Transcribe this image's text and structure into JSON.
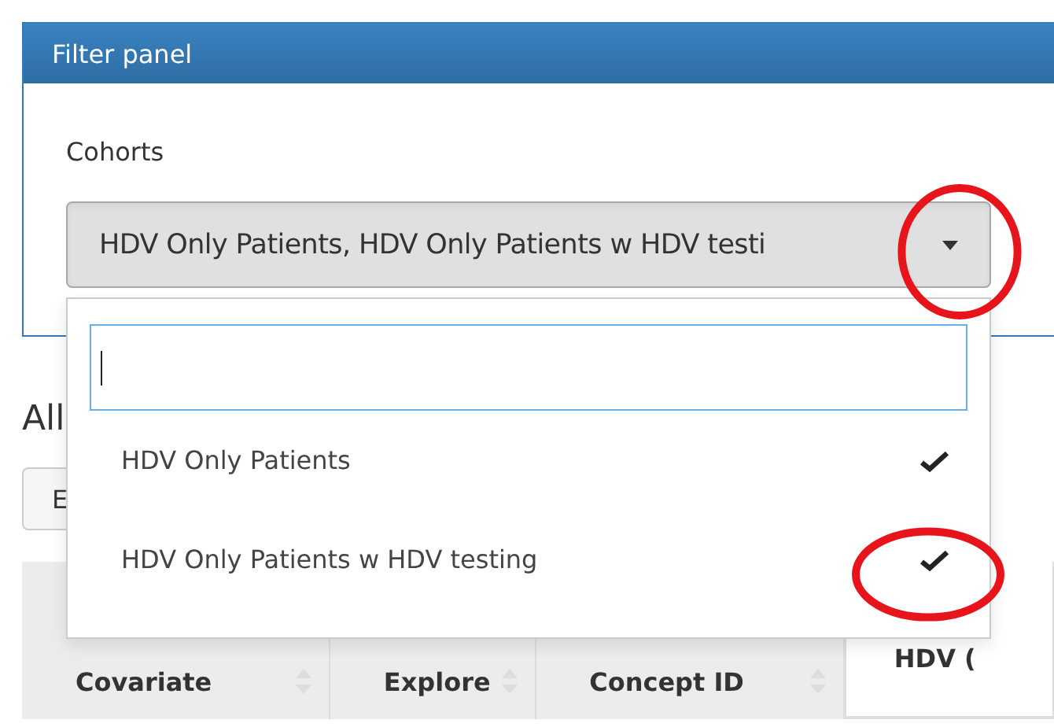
{
  "panel": {
    "title": "Filter panel",
    "cohorts": {
      "label": "Cohorts",
      "value": "HDV Only Patients, HDV Only Patients w HDV testi",
      "expanded": true,
      "options": [
        {
          "label": "HDV Only Patients",
          "selected": true
        },
        {
          "label": "HDV Only Patients w HDV testing",
          "selected": true
        }
      ]
    }
  },
  "heading": "All",
  "button": "E",
  "table": {
    "columns": [
      "Covariate",
      "Explore",
      "Concept ID"
    ],
    "group_column": "HDV ("
  },
  "annotations": [
    {
      "kind": "ellipse"
    },
    {
      "kind": "ellipse"
    }
  ]
}
